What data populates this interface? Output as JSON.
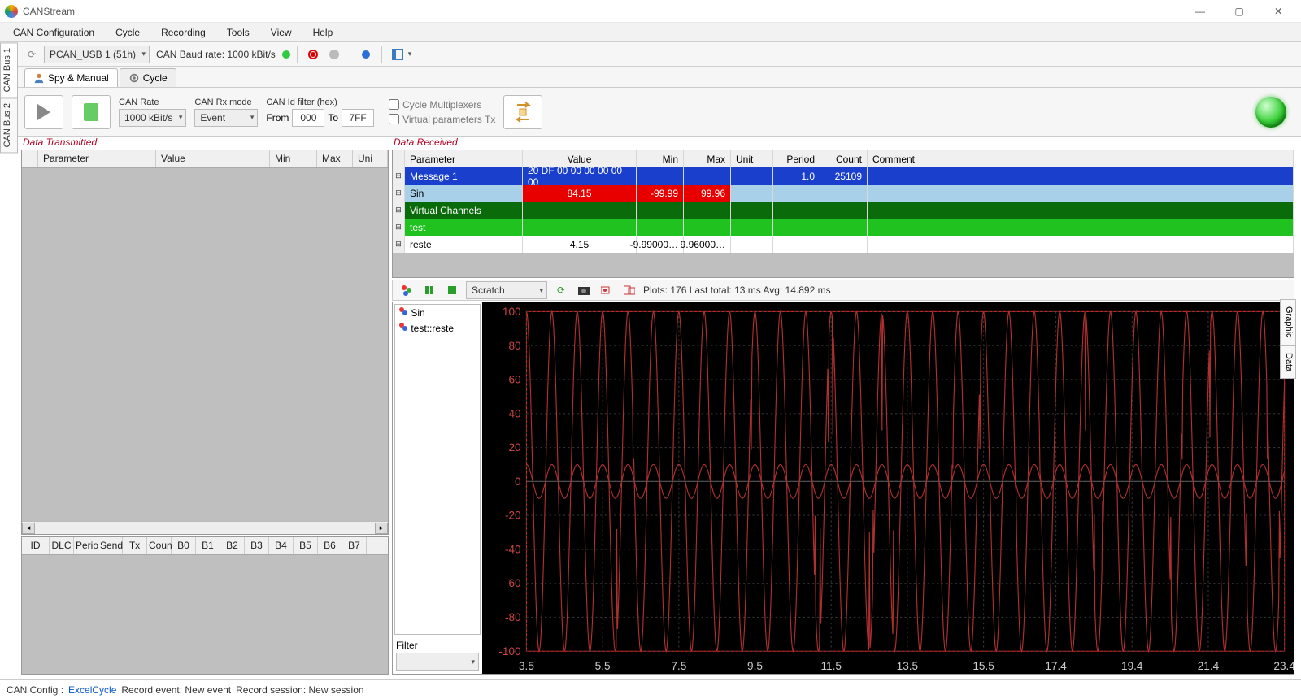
{
  "app": {
    "title": "CANStream"
  },
  "menubar": [
    "CAN Configuration",
    "Cycle",
    "Recording",
    "Tools",
    "View",
    "Help"
  ],
  "toolbar": {
    "device": "PCAN_USB 1 (51h)",
    "baud_label": "CAN Baud rate: 1000 kBit/s"
  },
  "lefttabs": [
    "CAN Bus 1",
    "CAN Bus 2"
  ],
  "subtabs": {
    "spy": "Spy & Manual",
    "cycle": "Cycle"
  },
  "config": {
    "can_rate_label": "CAN Rate",
    "can_rate_value": "1000 kBit/s",
    "rx_mode_label": "CAN Rx mode",
    "rx_mode_value": "Event",
    "idfilter_label": "CAN Id filter (hex)",
    "from_label": "From",
    "from_value": "000",
    "to_label": "To",
    "to_value": "7FF",
    "cycle_mux": "Cycle Multiplexers",
    "virtual_tx": "Virtual parameters Tx"
  },
  "tx_section_label": "Data Transmitted",
  "rx_section_label": "Data Received",
  "tx_headers": [
    "Parameter",
    "Value",
    "Min",
    "Max",
    "Uni"
  ],
  "rx_headers": [
    "Parameter",
    "Value",
    "Min",
    "Max",
    "Unit",
    "Period",
    "Count",
    "Comment"
  ],
  "rx_rows": [
    {
      "style": "blue",
      "param": "Message 1",
      "value": "20 DF 00 00 00 00 00 00",
      "min": "",
      "max": "",
      "unit": "",
      "period": "1.0",
      "count": "25109",
      "comment": ""
    },
    {
      "style": "lightblue",
      "param": "Sin",
      "value": "84.15",
      "min": "-99.99",
      "max": "99.96",
      "unit": "",
      "period": "",
      "count": "",
      "comment": "",
      "redcells": [
        "value",
        "min",
        "max"
      ]
    },
    {
      "style": "darkgreen",
      "param": "Virtual Channels",
      "value": "",
      "min": "",
      "max": "",
      "unit": "",
      "period": "",
      "count": "",
      "comment": ""
    },
    {
      "style": "green",
      "param": "test",
      "value": "",
      "min": "",
      "max": "",
      "unit": "",
      "period": "",
      "count": "",
      "comment": ""
    },
    {
      "style": "white",
      "param": "reste",
      "value": "4.15",
      "min": "-9.99000…",
      "max": "9.96000…",
      "unit": "",
      "period": "",
      "count": "",
      "comment": ""
    }
  ],
  "frame_headers": [
    "ID",
    "DLC",
    "Perio",
    "Send",
    "Tx",
    "Coun",
    "B0",
    "B1",
    "B2",
    "B3",
    "B4",
    "B5",
    "B6",
    "B7"
  ],
  "graph": {
    "preset": "Scratch",
    "stats": "Plots: 176  Last total: 13 ms  Avg: 14.892 ms",
    "signals": [
      "Sin",
      "test::reste"
    ],
    "filter_label": "Filter"
  },
  "rightvtabs": [
    "Graphic",
    "Data"
  ],
  "status": {
    "config_label": "CAN Config :",
    "config_value": "ExcelCycle",
    "event": "Record event: New event",
    "session": "Record session: New session"
  },
  "chart_data": {
    "type": "line",
    "title": "",
    "xlabel": "",
    "ylabel": "",
    "ylim": [
      -100,
      100
    ],
    "yticks": [
      -100,
      -80,
      -60,
      -40,
      -20,
      0,
      20,
      40,
      60,
      80,
      100
    ],
    "xlim": [
      3.5,
      23.4
    ],
    "xticks": [
      3.5,
      5.5,
      7.5,
      9.5,
      11.5,
      13.5,
      15.5,
      17.4,
      19.4,
      21.4,
      23.4
    ],
    "series": [
      {
        "name": "Sin",
        "color": "#b03030",
        "amplitude": 100,
        "frequency_hz": 1.5,
        "offset": 0,
        "note": "approx sinusoid with occasional harmonic blips"
      },
      {
        "name": "test::reste",
        "color": "#b03030",
        "amplitude": 10,
        "frequency_hz": 1.5,
        "offset": 0
      }
    ]
  }
}
